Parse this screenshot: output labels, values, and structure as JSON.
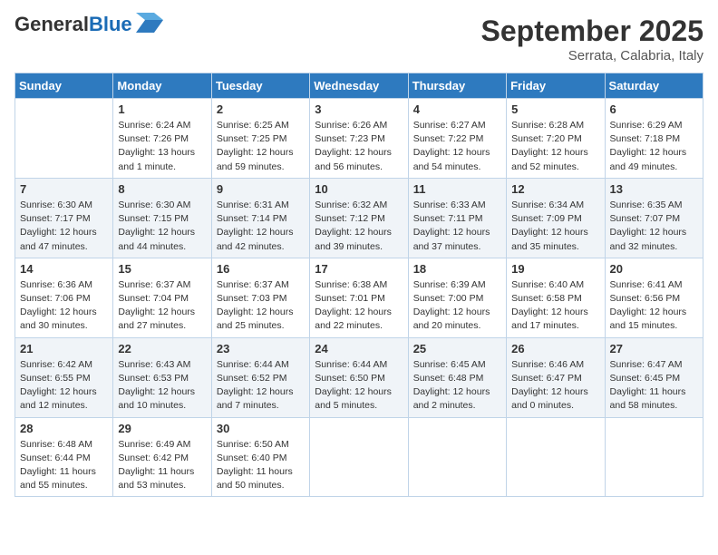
{
  "header": {
    "logo_line1": "General",
    "logo_line2": "Blue",
    "month": "September 2025",
    "location": "Serrata, Calabria, Italy"
  },
  "days_of_week": [
    "Sunday",
    "Monday",
    "Tuesday",
    "Wednesday",
    "Thursday",
    "Friday",
    "Saturday"
  ],
  "weeks": [
    [
      {
        "day": "",
        "info": ""
      },
      {
        "day": "1",
        "info": "Sunrise: 6:24 AM\nSunset: 7:26 PM\nDaylight: 13 hours\nand 1 minute."
      },
      {
        "day": "2",
        "info": "Sunrise: 6:25 AM\nSunset: 7:25 PM\nDaylight: 12 hours\nand 59 minutes."
      },
      {
        "day": "3",
        "info": "Sunrise: 6:26 AM\nSunset: 7:23 PM\nDaylight: 12 hours\nand 56 minutes."
      },
      {
        "day": "4",
        "info": "Sunrise: 6:27 AM\nSunset: 7:22 PM\nDaylight: 12 hours\nand 54 minutes."
      },
      {
        "day": "5",
        "info": "Sunrise: 6:28 AM\nSunset: 7:20 PM\nDaylight: 12 hours\nand 52 minutes."
      },
      {
        "day": "6",
        "info": "Sunrise: 6:29 AM\nSunset: 7:18 PM\nDaylight: 12 hours\nand 49 minutes."
      }
    ],
    [
      {
        "day": "7",
        "info": "Sunrise: 6:30 AM\nSunset: 7:17 PM\nDaylight: 12 hours\nand 47 minutes."
      },
      {
        "day": "8",
        "info": "Sunrise: 6:30 AM\nSunset: 7:15 PM\nDaylight: 12 hours\nand 44 minutes."
      },
      {
        "day": "9",
        "info": "Sunrise: 6:31 AM\nSunset: 7:14 PM\nDaylight: 12 hours\nand 42 minutes."
      },
      {
        "day": "10",
        "info": "Sunrise: 6:32 AM\nSunset: 7:12 PM\nDaylight: 12 hours\nand 39 minutes."
      },
      {
        "day": "11",
        "info": "Sunrise: 6:33 AM\nSunset: 7:11 PM\nDaylight: 12 hours\nand 37 minutes."
      },
      {
        "day": "12",
        "info": "Sunrise: 6:34 AM\nSunset: 7:09 PM\nDaylight: 12 hours\nand 35 minutes."
      },
      {
        "day": "13",
        "info": "Sunrise: 6:35 AM\nSunset: 7:07 PM\nDaylight: 12 hours\nand 32 minutes."
      }
    ],
    [
      {
        "day": "14",
        "info": "Sunrise: 6:36 AM\nSunset: 7:06 PM\nDaylight: 12 hours\nand 30 minutes."
      },
      {
        "day": "15",
        "info": "Sunrise: 6:37 AM\nSunset: 7:04 PM\nDaylight: 12 hours\nand 27 minutes."
      },
      {
        "day": "16",
        "info": "Sunrise: 6:37 AM\nSunset: 7:03 PM\nDaylight: 12 hours\nand 25 minutes."
      },
      {
        "day": "17",
        "info": "Sunrise: 6:38 AM\nSunset: 7:01 PM\nDaylight: 12 hours\nand 22 minutes."
      },
      {
        "day": "18",
        "info": "Sunrise: 6:39 AM\nSunset: 7:00 PM\nDaylight: 12 hours\nand 20 minutes."
      },
      {
        "day": "19",
        "info": "Sunrise: 6:40 AM\nSunset: 6:58 PM\nDaylight: 12 hours\nand 17 minutes."
      },
      {
        "day": "20",
        "info": "Sunrise: 6:41 AM\nSunset: 6:56 PM\nDaylight: 12 hours\nand 15 minutes."
      }
    ],
    [
      {
        "day": "21",
        "info": "Sunrise: 6:42 AM\nSunset: 6:55 PM\nDaylight: 12 hours\nand 12 minutes."
      },
      {
        "day": "22",
        "info": "Sunrise: 6:43 AM\nSunset: 6:53 PM\nDaylight: 12 hours\nand 10 minutes."
      },
      {
        "day": "23",
        "info": "Sunrise: 6:44 AM\nSunset: 6:52 PM\nDaylight: 12 hours\nand 7 minutes."
      },
      {
        "day": "24",
        "info": "Sunrise: 6:44 AM\nSunset: 6:50 PM\nDaylight: 12 hours\nand 5 minutes."
      },
      {
        "day": "25",
        "info": "Sunrise: 6:45 AM\nSunset: 6:48 PM\nDaylight: 12 hours\nand 2 minutes."
      },
      {
        "day": "26",
        "info": "Sunrise: 6:46 AM\nSunset: 6:47 PM\nDaylight: 12 hours\nand 0 minutes."
      },
      {
        "day": "27",
        "info": "Sunrise: 6:47 AM\nSunset: 6:45 PM\nDaylight: 11 hours\nand 58 minutes."
      }
    ],
    [
      {
        "day": "28",
        "info": "Sunrise: 6:48 AM\nSunset: 6:44 PM\nDaylight: 11 hours\nand 55 minutes."
      },
      {
        "day": "29",
        "info": "Sunrise: 6:49 AM\nSunset: 6:42 PM\nDaylight: 11 hours\nand 53 minutes."
      },
      {
        "day": "30",
        "info": "Sunrise: 6:50 AM\nSunset: 6:40 PM\nDaylight: 11 hours\nand 50 minutes."
      },
      {
        "day": "",
        "info": ""
      },
      {
        "day": "",
        "info": ""
      },
      {
        "day": "",
        "info": ""
      },
      {
        "day": "",
        "info": ""
      }
    ]
  ]
}
